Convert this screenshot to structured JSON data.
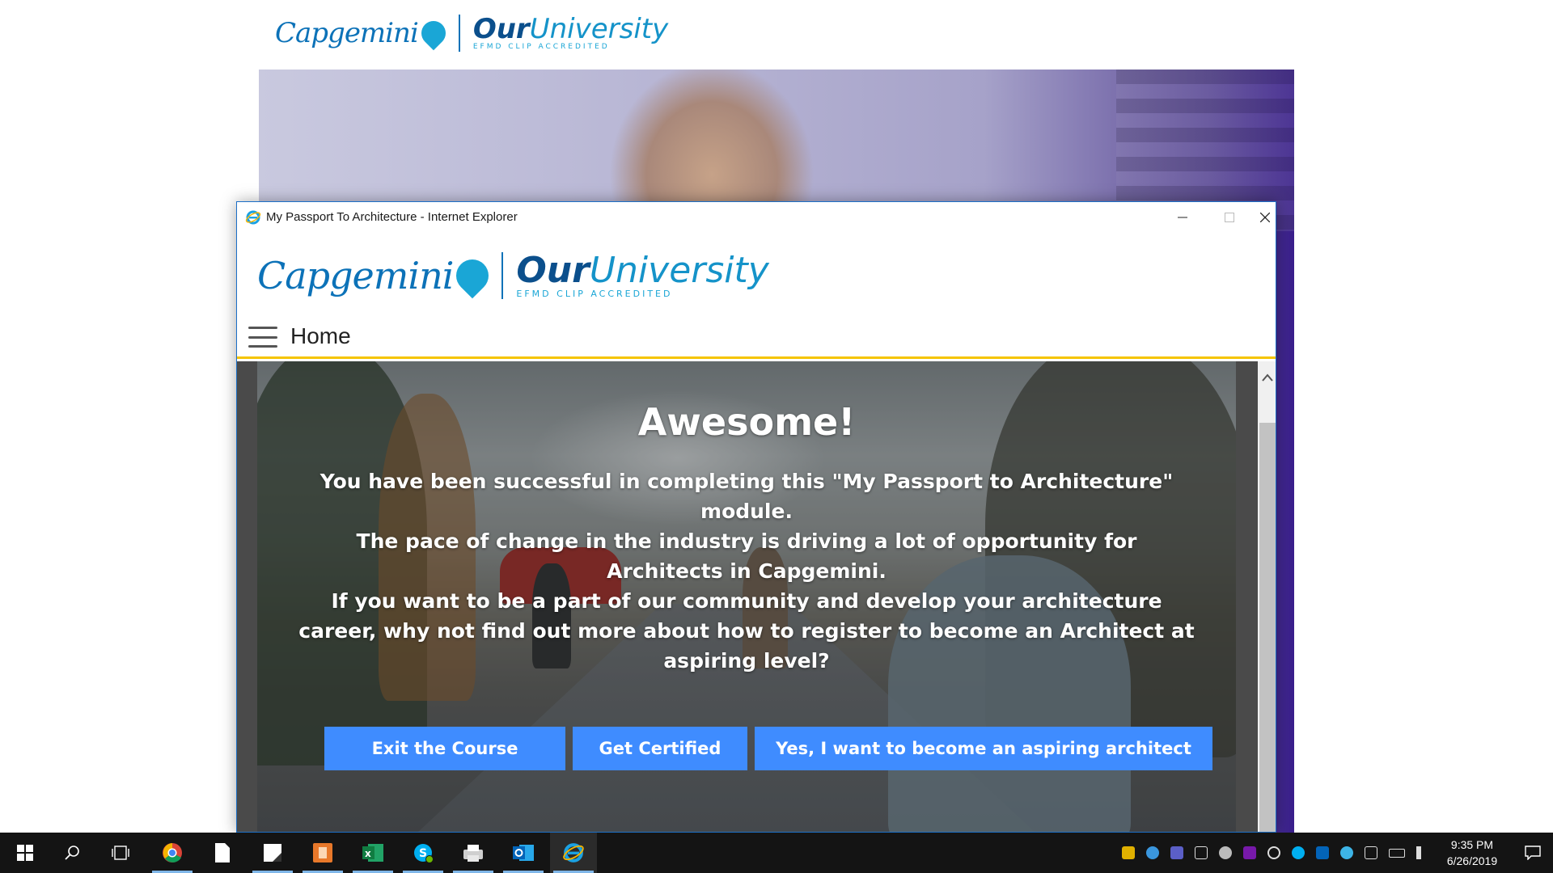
{
  "brand": {
    "capgemini": "Capgemini",
    "our": "Our",
    "university": "University",
    "efmd": "EFMD CLIP ACCREDITED"
  },
  "window": {
    "title": "My Passport To Architecture - Internet Explorer"
  },
  "nav": {
    "title": "Home"
  },
  "hero": {
    "heading": "Awesome!",
    "line1": "You have been successful in completing this \"My Passport to Architecture\" module.",
    "line2": "The pace of change in the industry is driving a lot of opportunity for Architects in Capgemini.",
    "line3": "If you want to be a part of our community and develop your architecture career, why not find out more about how to register to become an Architect at aspiring level?"
  },
  "buttons": {
    "exit": "Exit the Course",
    "certified": "Get Certified",
    "aspiring": "Yes, I want to become an aspiring architect"
  },
  "colors": {
    "brand_blue": "#0c72b8",
    "accent_yellow": "#f5c400",
    "button_blue": "#3f8cff"
  },
  "taskbar": {
    "apps": [
      "start-icon",
      "search-icon",
      "task-view-icon",
      "chrome-icon",
      "file-icon",
      "notes-icon",
      "powerpoint-icon",
      "excel-icon",
      "skype-icon",
      "printer-icon",
      "outlook-icon",
      "internet-explorer-icon"
    ],
    "time": "9:35 PM",
    "date": "6/26/2019"
  }
}
